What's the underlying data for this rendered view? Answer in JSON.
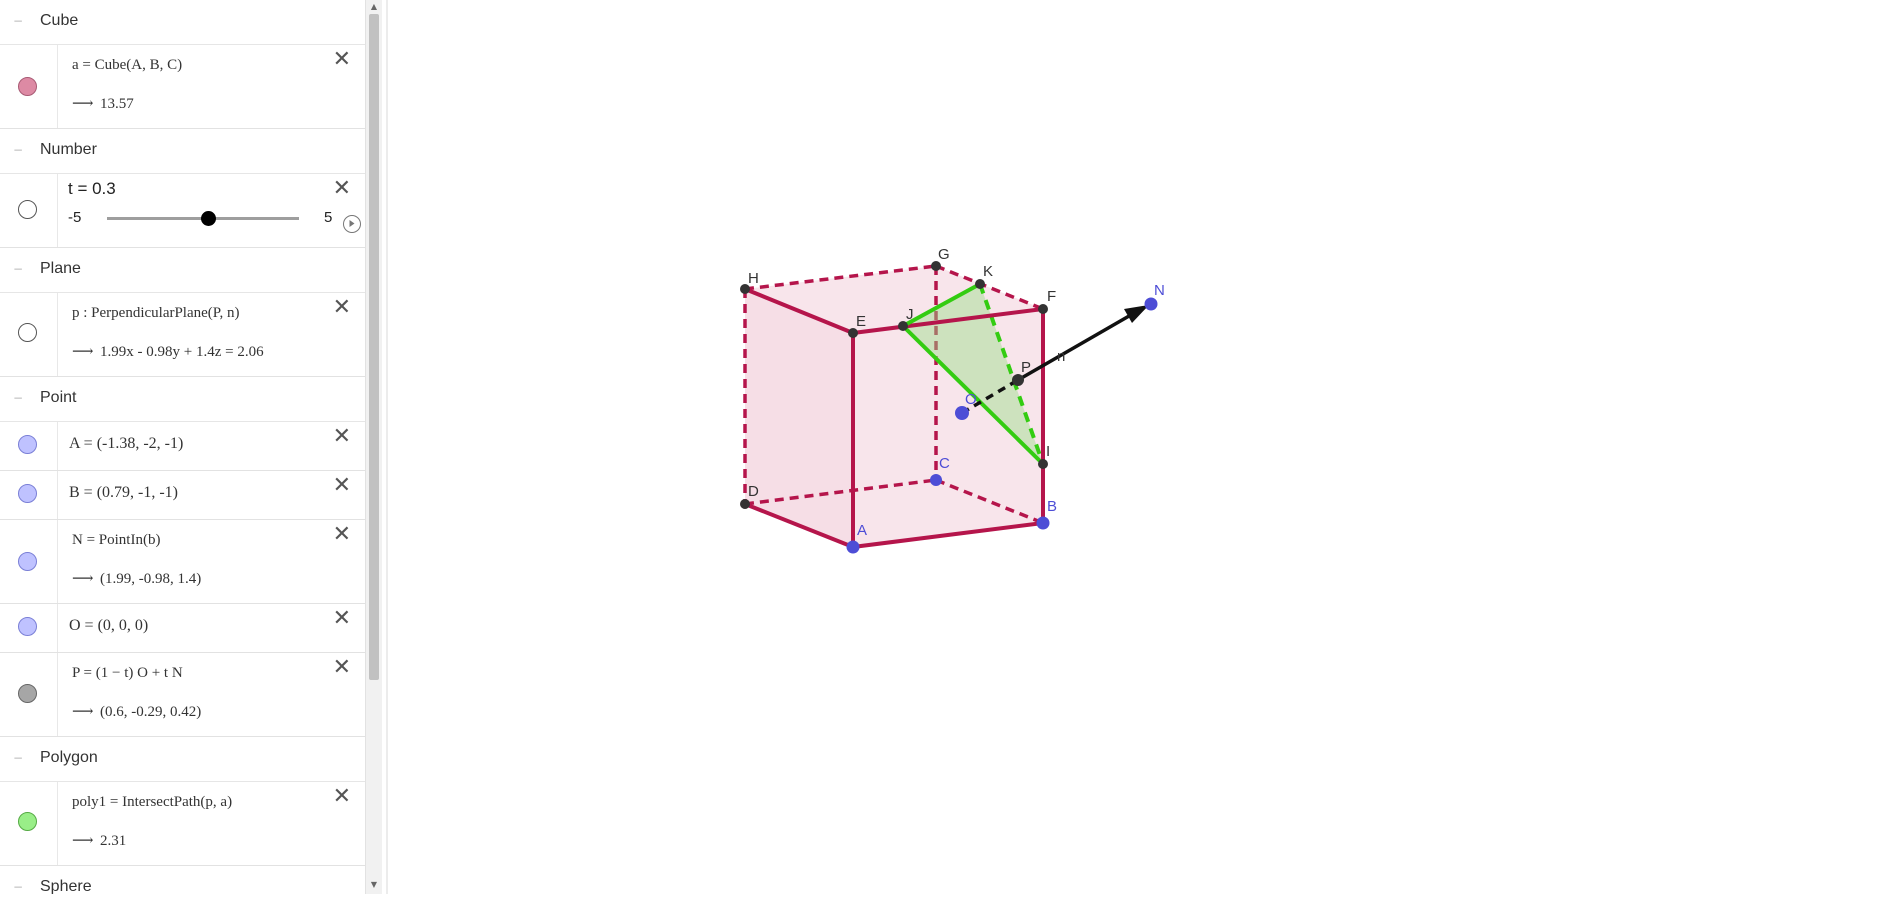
{
  "algebra": {
    "groups": [
      {
        "title": "Cube"
      },
      {
        "title": "Number"
      },
      {
        "title": "Plane"
      },
      {
        "title": "Point"
      },
      {
        "title": "Polygon"
      },
      {
        "title": "Sphere"
      }
    ],
    "cube": {
      "definition": "a = Cube(A, B, C)",
      "value": "13.57",
      "color": "#dd8aa4"
    },
    "slider": {
      "text": "t = 0.3",
      "min": "-5",
      "max": "5",
      "value": 0.3,
      "min_value": -5,
      "max_value": 5
    },
    "plane": {
      "definition": "p : PerpendicularPlane(P, n)",
      "value": "1.99x - 0.98y + 1.4z = 2.06"
    },
    "points": [
      {
        "text": "A = (-1.38, -2, -1)",
        "color": "#bfc2ff"
      },
      {
        "text": "B = (0.79, -1, -1)",
        "color": "#bfc2ff"
      },
      {
        "definition": "N = PointIn(b)",
        "value": "(1.99, -0.98, 1.4)",
        "color": "#bfc2ff"
      },
      {
        "text": "O = (0, 0, 0)",
        "color": "#bfc2ff"
      },
      {
        "definition": "P = (1 − t) O + t N",
        "value": "(0.6, -0.29, 0.42)",
        "color": "#a6a6a6"
      }
    ],
    "polygon": {
      "definition": "poly1 = IntersectPath(p, a)",
      "value": "2.31",
      "color": "#99ee88"
    },
    "close_symbol": "✕",
    "arrow_symbol": "⟶",
    "collapse_symbol": "−"
  },
  "graphics": {
    "labels": {
      "A": "A",
      "B": "B",
      "C": "C",
      "D": "D",
      "E": "E",
      "F": "F",
      "G": "G",
      "H": "H",
      "I": "I",
      "J": "J",
      "K": "K",
      "N": "N",
      "O": "O",
      "P": "P",
      "n": "n"
    },
    "colors": {
      "cube_edge": "#b5154b",
      "cube_fill": "#dd8aa4",
      "polygon": "#33cc11",
      "free_point": "#4d4dd6",
      "dependent_point": "#333333",
      "label_blue": "#4d4dd6"
    }
  }
}
